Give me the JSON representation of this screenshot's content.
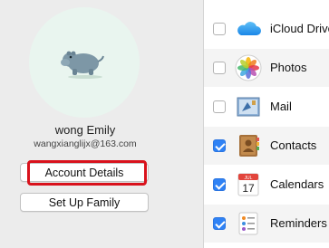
{
  "account": {
    "name": "wong Emily",
    "email": "wangxianglijx@163.com",
    "account_details_label": "Account Details",
    "set_up_family_label": "Set Up Family"
  },
  "services": {
    "items": [
      {
        "label": "iCloud Drive",
        "checked": false,
        "icon": "icloud-drive-icon"
      },
      {
        "label": "Photos",
        "checked": false,
        "icon": "photos-icon"
      },
      {
        "label": "Mail",
        "checked": false,
        "icon": "mail-icon"
      },
      {
        "label": "Contacts",
        "checked": true,
        "icon": "contacts-icon"
      },
      {
        "label": "Calendars",
        "checked": true,
        "icon": "calendar-icon"
      },
      {
        "label": "Reminders",
        "checked": true,
        "icon": "reminders-icon"
      }
    ],
    "calendar_icon_month": "JUL",
    "calendar_icon_day": "17"
  },
  "colors": {
    "highlight": "#d9121c",
    "checkbox_checked": "#2f82f5"
  }
}
